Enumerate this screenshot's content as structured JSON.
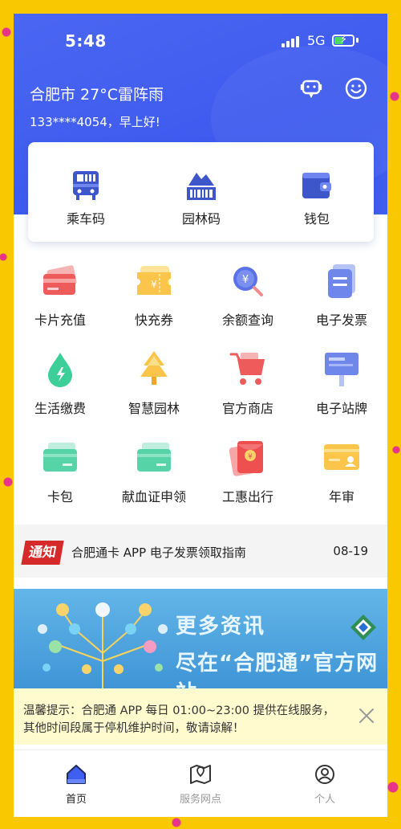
{
  "status": {
    "time": "5:48",
    "network": "5G"
  },
  "header": {
    "weather": "合肥市  27°C雷阵雨",
    "greeting": "133****4054，早上好!"
  },
  "quick_actions": [
    {
      "label": "乘车码",
      "icon": "bus-qr-icon"
    },
    {
      "label": "园林码",
      "icon": "park-code-icon"
    },
    {
      "label": "钱包",
      "icon": "wallet-icon"
    }
  ],
  "services": [
    {
      "label": "卡片充值",
      "icon": "card-recharge-icon"
    },
    {
      "label": "快充券",
      "icon": "coupon-icon"
    },
    {
      "label": "余额查询",
      "icon": "balance-search-icon"
    },
    {
      "label": "电子发票",
      "icon": "e-invoice-icon"
    },
    {
      "label": "生活缴费",
      "icon": "utility-payment-icon"
    },
    {
      "label": "智慧园林",
      "icon": "smart-park-icon"
    },
    {
      "label": "官方商店",
      "icon": "shop-cart-icon"
    },
    {
      "label": "电子站牌",
      "icon": "e-station-sign-icon"
    },
    {
      "label": "卡包",
      "icon": "card-pack-icon"
    },
    {
      "label": "献血证申领",
      "icon": "blood-donation-card-icon"
    },
    {
      "label": "工惠出行",
      "icon": "red-envelope-icon"
    },
    {
      "label": "年审",
      "icon": "annual-review-icon"
    }
  ],
  "notice": {
    "tag": "通知",
    "text": "合肥通卡 APP 电子发票领取指南",
    "date": "08-19"
  },
  "banner": {
    "title1": "更多资讯",
    "title2": "尽在“合肥通”官方网站"
  },
  "tip": {
    "line1": "温馨提示：合肥通 APP 每日 01:00~23:00 提供在线服务，",
    "line2": "其他时间段属于停机维护时间，敬请谅解！"
  },
  "tabs": [
    {
      "label": "首页",
      "active": true
    },
    {
      "label": "服务网点",
      "active": false
    },
    {
      "label": "个人",
      "active": false
    }
  ],
  "colors": {
    "primary": "#3f5ff0",
    "notice_red": "#d62a2a",
    "tip_bg": "#fffbcf"
  }
}
